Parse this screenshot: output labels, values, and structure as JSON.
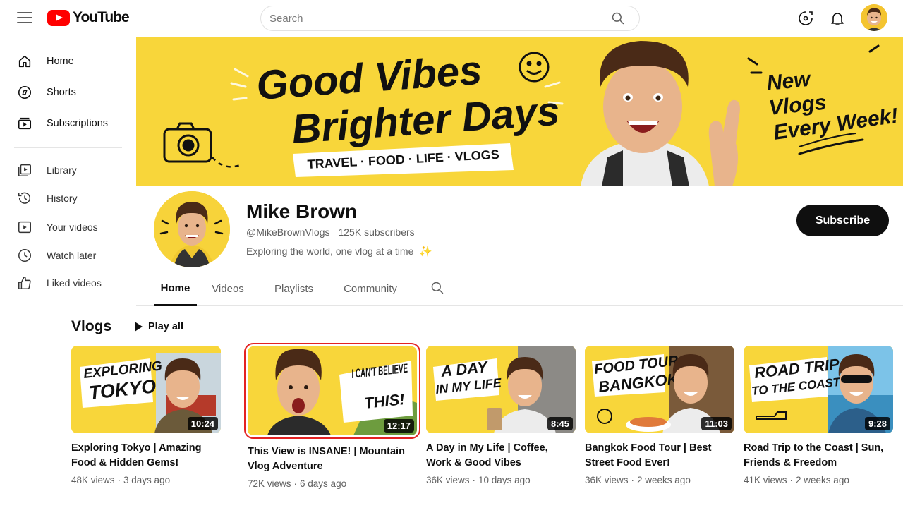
{
  "topbar": {
    "logo_text": "YouTube",
    "search_placeholder": "Search",
    "search_value": ""
  },
  "sidebar": {
    "items": [
      {
        "label": "Home",
        "icon": "home-icon"
      },
      {
        "label": "Shorts",
        "icon": "shorts-icon"
      },
      {
        "label": "Subscriptions",
        "icon": "subscriptions-icon"
      },
      {
        "label": "Library",
        "icon": "library-icon"
      },
      {
        "label": "History",
        "icon": "history-icon"
      },
      {
        "label": "Your videos",
        "icon": "your-videos-icon"
      },
      {
        "label": "Watch later",
        "icon": "watch-later-icon"
      },
      {
        "label": "Liked videos",
        "icon": "liked-videos-icon"
      }
    ]
  },
  "banner": {
    "headline_1": "Good Vibes",
    "headline_2": "Brighter Days",
    "tags": "TRAVEL · FOOD · LIFE · VLOGS",
    "side_1": "New",
    "side_2": "Vlogs",
    "side_3": "Every Week!"
  },
  "channel": {
    "name": "Mike Brown",
    "handle": "@MikeBrownVlogs",
    "subscribers": "125K subscribers",
    "description": "Exploring the world, one vlog at a time",
    "description_emoji": "✨",
    "subscribe_label": "Subscribe"
  },
  "tabs": [
    {
      "label": "Home",
      "active": true
    },
    {
      "label": "Videos",
      "active": false
    },
    {
      "label": "Playlists",
      "active": false
    },
    {
      "label": "Community",
      "active": false
    }
  ],
  "section": {
    "title": "Vlogs",
    "play_all_label": "Play all"
  },
  "videos": [
    {
      "thumb_text_1": "EXPLORING",
      "thumb_text_2": "TOKYO",
      "duration": "10:24",
      "title": "Exploring Tokyo | Amazing Food & Hidden Gems!",
      "views": "48K views",
      "age": "3 days ago",
      "selected": false
    },
    {
      "thumb_text_1": "I CAN'T BELIEVE",
      "thumb_text_2": "THIS!",
      "duration": "12:17",
      "title": "This View is INSANE! | Mountain Vlog Adventure",
      "views": "72K views",
      "age": "6 days ago",
      "selected": true
    },
    {
      "thumb_text_1": "A DAY",
      "thumb_text_2": "IN MY LIFE",
      "duration": "8:45",
      "title": "A Day in My Life | Coffee, Work & Good Vibes",
      "views": "36K views",
      "age": "10 days ago",
      "selected": false
    },
    {
      "thumb_text_1": "FOOD TOUR",
      "thumb_text_2": "BANGKOK",
      "duration": "11:03",
      "title": "Bangkok Food Tour | Best Street Food Ever!",
      "views": "36K views",
      "age": "2 weeks ago",
      "selected": false
    },
    {
      "thumb_text_1": "ROAD TRIP",
      "thumb_text_2": "TO THE COAST",
      "duration": "9:28",
      "title": "Road Trip to the Coast | Sun, Friends & Freedom",
      "views": "41K views",
      "age": "2 weeks ago",
      "selected": false
    }
  ],
  "colors": {
    "brand_red": "#ff0000",
    "banner_yellow": "#f8d63a",
    "selection_red": "#e32222",
    "text_primary": "#0f0f0f",
    "text_secondary": "#606060"
  }
}
